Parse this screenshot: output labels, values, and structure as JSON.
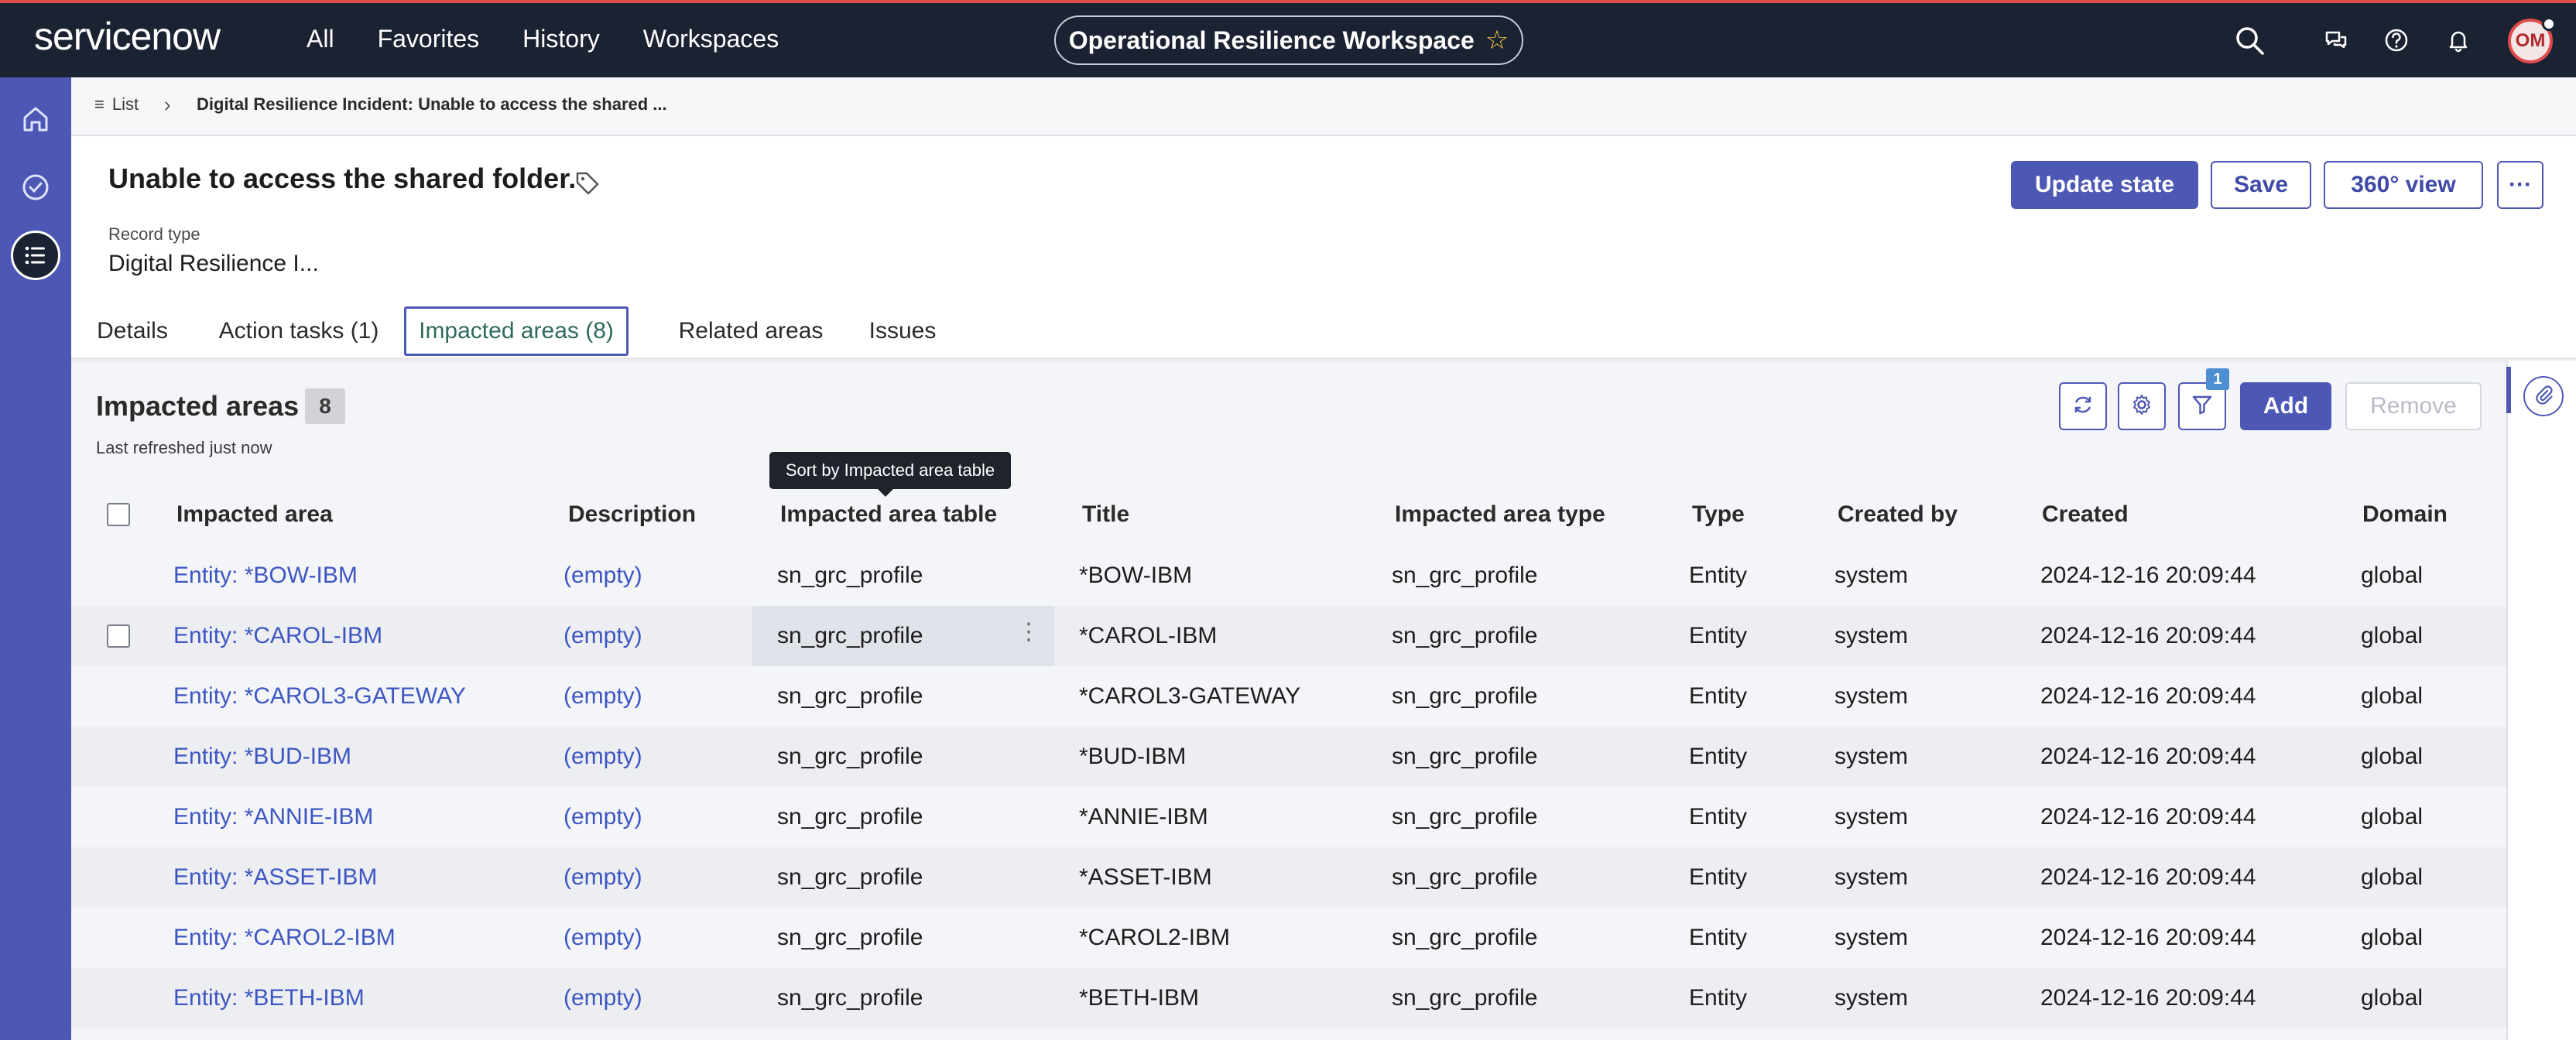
{
  "header": {
    "logo": "servicenow",
    "nav": [
      "All",
      "Favorites",
      "History",
      "Workspaces"
    ],
    "workspace": "Operational Resilience Workspace",
    "avatar_initials": "OM",
    "icons": [
      "search-icon",
      "chat-icon",
      "help-icon",
      "bell-icon"
    ]
  },
  "rail": {
    "icons": [
      "home-icon",
      "check-circle-icon",
      "list-icon"
    ]
  },
  "breadcrumb": {
    "list_label": "List",
    "current": "Digital Resilience Incident: Unable to access the shared ..."
  },
  "record": {
    "title": "Unable to access the shared folder.",
    "type_label": "Record type",
    "type_value": "Digital Resilience I...",
    "buttons": {
      "update_state": "Update state",
      "save": "Save",
      "view360": "360° view",
      "more": "···"
    }
  },
  "tabs": [
    "Details",
    "Action tasks (1)",
    "Impacted areas (8)",
    "Related areas",
    "Issues"
  ],
  "panel": {
    "title": "Impacted areas",
    "count": "8",
    "refreshed": "Last refreshed just now",
    "filter_count": "1",
    "add_label": "Add",
    "remove_label": "Remove",
    "tooltip": "Sort by Impacted area table"
  },
  "table": {
    "columns": [
      "Impacted area",
      "Description",
      "Impacted area table",
      "Title",
      "Impacted area type",
      "Type",
      "Created by",
      "Created",
      "Domain"
    ],
    "rows": [
      [
        "Entity: *BOW-IBM",
        "(empty)",
        "sn_grc_profile",
        "*BOW-IBM",
        "sn_grc_profile",
        "Entity",
        "system",
        "2024-12-16 20:09:44",
        "global"
      ],
      [
        "Entity: *CAROL-IBM",
        "(empty)",
        "sn_grc_profile",
        "*CAROL-IBM",
        "sn_grc_profile",
        "Entity",
        "system",
        "2024-12-16 20:09:44",
        "global"
      ],
      [
        "Entity: *CAROL3-GATEWAY",
        "(empty)",
        "sn_grc_profile",
        "*CAROL3-GATEWAY",
        "sn_grc_profile",
        "Entity",
        "system",
        "2024-12-16 20:09:44",
        "global"
      ],
      [
        "Entity: *BUD-IBM",
        "(empty)",
        "sn_grc_profile",
        "*BUD-IBM",
        "sn_grc_profile",
        "Entity",
        "system",
        "2024-12-16 20:09:44",
        "global"
      ],
      [
        "Entity: *ANNIE-IBM",
        "(empty)",
        "sn_grc_profile",
        "*ANNIE-IBM",
        "sn_grc_profile",
        "Entity",
        "system",
        "2024-12-16 20:09:44",
        "global"
      ],
      [
        "Entity: *ASSET-IBM",
        "(empty)",
        "sn_grc_profile",
        "*ASSET-IBM",
        "sn_grc_profile",
        "Entity",
        "system",
        "2024-12-16 20:09:44",
        "global"
      ],
      [
        "Entity: *CAROL2-IBM",
        "(empty)",
        "sn_grc_profile",
        "*CAROL2-IBM",
        "sn_grc_profile",
        "Entity",
        "system",
        "2024-12-16 20:09:44",
        "global"
      ],
      [
        "Entity: *BETH-IBM",
        "(empty)",
        "sn_grc_profile",
        "*BETH-IBM",
        "sn_grc_profile",
        "Entity",
        "system",
        "2024-12-16 20:09:44",
        "global"
      ]
    ]
  },
  "colors": {
    "header_bg": "#1b2232",
    "rail_bg": "#4d58b4",
    "primary": "#4d58b4",
    "link": "#3d56c2",
    "accent_red": "#e04b4b"
  }
}
